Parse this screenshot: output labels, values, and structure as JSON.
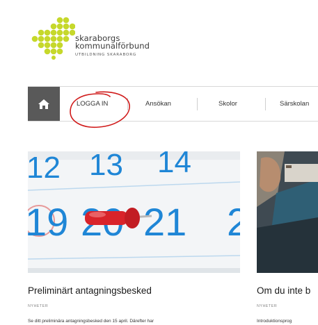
{
  "logo": {
    "line1": "skaraborgs",
    "line2": "kommunalförbund",
    "line3": "UTBILDNING SKARABORG",
    "color": "#c6d82b"
  },
  "nav": {
    "home_icon": "home-icon",
    "items": [
      "LOGGA IN",
      "Ansökan",
      "Skolor",
      "Särskolan"
    ]
  },
  "cards": [
    {
      "title": "Preliminärt antagningsbesked",
      "category": "NYHETER",
      "excerpt": "Se ditt preliminära antagningsbesked den 15 april. Därefter har",
      "calendar_numbers": [
        "12",
        "13",
        "14",
        "19",
        "20",
        "21",
        "2"
      ]
    },
    {
      "title": "Om du inte b",
      "category": "NYHETER",
      "excerpt": "Introduktionsprog"
    }
  ],
  "colors": {
    "calendar_blue": "#1f86d6",
    "pin_red": "#d9232a",
    "annotation_red": "#d01a1a",
    "nav_home_bg": "#595959"
  }
}
